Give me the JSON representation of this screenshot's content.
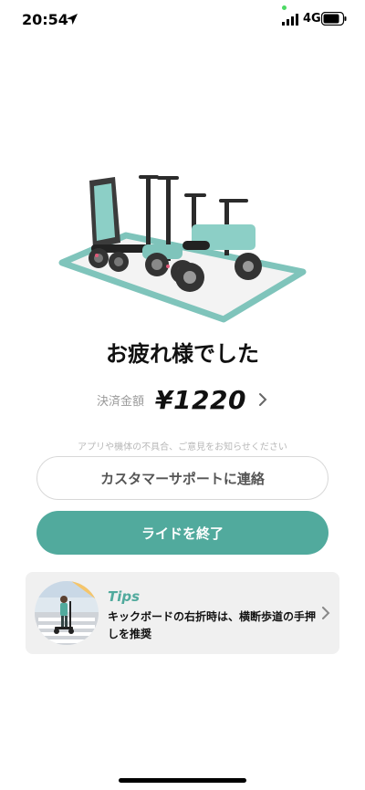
{
  "status_bar": {
    "time": "20:54",
    "network": "4G",
    "location_icon": "location-arrow-icon",
    "signal_icon": "cellular-signal-icon",
    "battery_icon": "battery-icon"
  },
  "hero": {
    "image": "parked-scooters-and-bikes-illustration"
  },
  "main": {
    "title": "お疲れ様でした",
    "fare_label": "決済金額",
    "fare_amount": "¥1220",
    "feedback_note": "アプリや機体の不具合、ご意見をお知らせください",
    "support_button": "カスタマーサポートに連絡",
    "end_ride_button": "ライドを終了"
  },
  "tips": {
    "heading": "Tips",
    "text": "キックボードの右折時は、横断歩道の手押しを推奨",
    "image": "scooter-crosswalk-illustration",
    "chevron_icon": "chevron-right-icon"
  },
  "colors": {
    "accent": "#51aa9d",
    "button_text_secondary": "#555555",
    "card_background": "#f0f0f0"
  }
}
